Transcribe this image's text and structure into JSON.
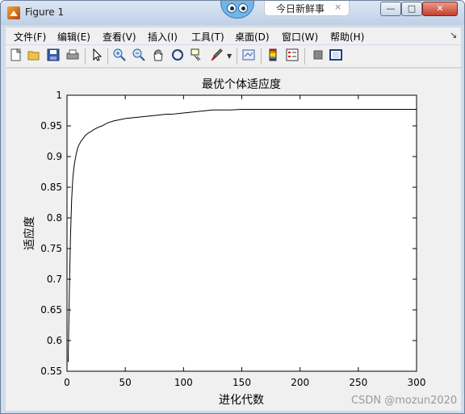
{
  "window": {
    "title": "Figure 1",
    "overlay_tab": "今日新鲜事",
    "overlay_close": "×",
    "minimize": "—",
    "maximize": "□",
    "close": "✕"
  },
  "menu": {
    "items": [
      "文件(F)",
      "编辑(E)",
      "查看(V)",
      "插入(I)",
      "工具(T)",
      "桌面(D)",
      "窗口(W)",
      "帮助(H)"
    ],
    "more": "↘"
  },
  "toolbar": {
    "icons": [
      "new-figure-icon",
      "open-file-icon",
      "save-icon",
      "print-icon",
      "select-arrow-icon",
      "zoom-in-icon",
      "zoom-out-icon",
      "pan-hand-icon",
      "rotate-3d-icon",
      "data-cursor-icon",
      "brush-icon",
      "link-plot-icon",
      "colorbar-icon",
      "legend-icon",
      "hide-plot-tools-icon",
      "show-plot-tools-icon"
    ]
  },
  "chart_data": {
    "type": "line",
    "title": "最优个体适应度",
    "xlabel": "进化代数",
    "ylabel": "适应度",
    "xlim": [
      0,
      300
    ],
    "ylim": [
      0.55,
      1
    ],
    "xticks": [
      "0",
      "50",
      "100",
      "150",
      "200",
      "250",
      "300"
    ],
    "yticks": [
      "0.55",
      "0.6",
      "0.65",
      "0.7",
      "0.75",
      "0.8",
      "0.85",
      "0.9",
      "0.95",
      "1"
    ],
    "grid": false,
    "series": [
      {
        "color": "#000000",
        "x": [
          1,
          2,
          3,
          4,
          5,
          6,
          7,
          8,
          9,
          10,
          12,
          14,
          16,
          18,
          20,
          23,
          26,
          30,
          35,
          40,
          45,
          50,
          55,
          60,
          65,
          70,
          75,
          80,
          85,
          90,
          95,
          100,
          105,
          110,
          115,
          120,
          125,
          130,
          140,
          150,
          160,
          170,
          180,
          190,
          200,
          210,
          220,
          230,
          240,
          250,
          260,
          270,
          280,
          290,
          300
        ],
        "y": [
          0.565,
          0.68,
          0.77,
          0.83,
          0.865,
          0.883,
          0.895,
          0.905,
          0.913,
          0.918,
          0.925,
          0.93,
          0.935,
          0.938,
          0.94,
          0.944,
          0.947,
          0.95,
          0.955,
          0.958,
          0.96,
          0.962,
          0.963,
          0.964,
          0.965,
          0.966,
          0.967,
          0.968,
          0.969,
          0.969,
          0.97,
          0.971,
          0.972,
          0.973,
          0.974,
          0.975,
          0.976,
          0.976,
          0.976,
          0.977,
          0.977,
          0.977,
          0.977,
          0.977,
          0.977,
          0.977,
          0.977,
          0.977,
          0.977,
          0.977,
          0.977,
          0.977,
          0.977,
          0.977,
          0.977
        ]
      }
    ]
  },
  "watermark": "CSDN @mozun2020"
}
